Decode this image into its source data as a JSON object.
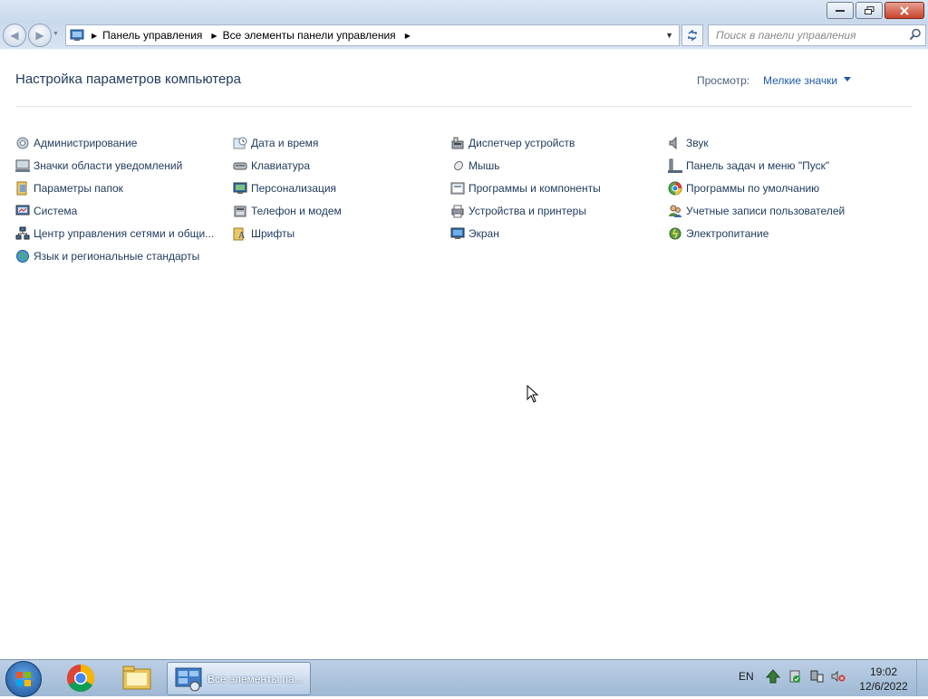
{
  "window": {
    "minimize_icon": "minimize-icon",
    "maximize_icon": "restore-icon",
    "close_icon": "close-icon"
  },
  "address": {
    "crumbs": [
      "Панель управления",
      "Все элементы панели управления"
    ],
    "search_placeholder": "Поиск в панели управления"
  },
  "main": {
    "heading": "Настройка параметров компьютера",
    "view_label": "Просмотр:",
    "view_value": "Мелкие значки"
  },
  "items": [
    {
      "label": "Администрирование",
      "icon": "admin-tools-icon"
    },
    {
      "label": "Дата и время",
      "icon": "clock-icon"
    },
    {
      "label": "Диспетчер устройств",
      "icon": "device-manager-icon"
    },
    {
      "label": "Звук",
      "icon": "speaker-icon"
    },
    {
      "label": "Значки области уведомлений",
      "icon": "notification-area-icon"
    },
    {
      "label": "Клавиатура",
      "icon": "keyboard-icon"
    },
    {
      "label": "Мышь",
      "icon": "mouse-icon"
    },
    {
      "label": "Панель задач и меню \"Пуск\"",
      "icon": "taskbar-icon"
    },
    {
      "label": "Параметры папок",
      "icon": "folder-options-icon"
    },
    {
      "label": "Персонализация",
      "icon": "personalization-icon"
    },
    {
      "label": "Программы и компоненты",
      "icon": "programs-icon"
    },
    {
      "label": "Программы по умолчанию",
      "icon": "default-programs-icon"
    },
    {
      "label": "Система",
      "icon": "system-icon"
    },
    {
      "label": "Телефон и модем",
      "icon": "phone-modem-icon"
    },
    {
      "label": "Устройства и принтеры",
      "icon": "printer-icon"
    },
    {
      "label": "Учетные записи пользователей",
      "icon": "user-accounts-icon"
    },
    {
      "label": "Центр управления сетями и общи...",
      "icon": "network-icon"
    },
    {
      "label": "Шрифты",
      "icon": "fonts-icon"
    },
    {
      "label": "Экран",
      "icon": "display-icon"
    },
    {
      "label": "Электропитание",
      "icon": "power-icon"
    },
    {
      "label": "Язык и региональные стандарты",
      "icon": "region-language-icon"
    }
  ],
  "taskbar": {
    "active_task": "Все элементы па...",
    "language": "EN",
    "time": "19:02",
    "date": "12/6/2022"
  }
}
